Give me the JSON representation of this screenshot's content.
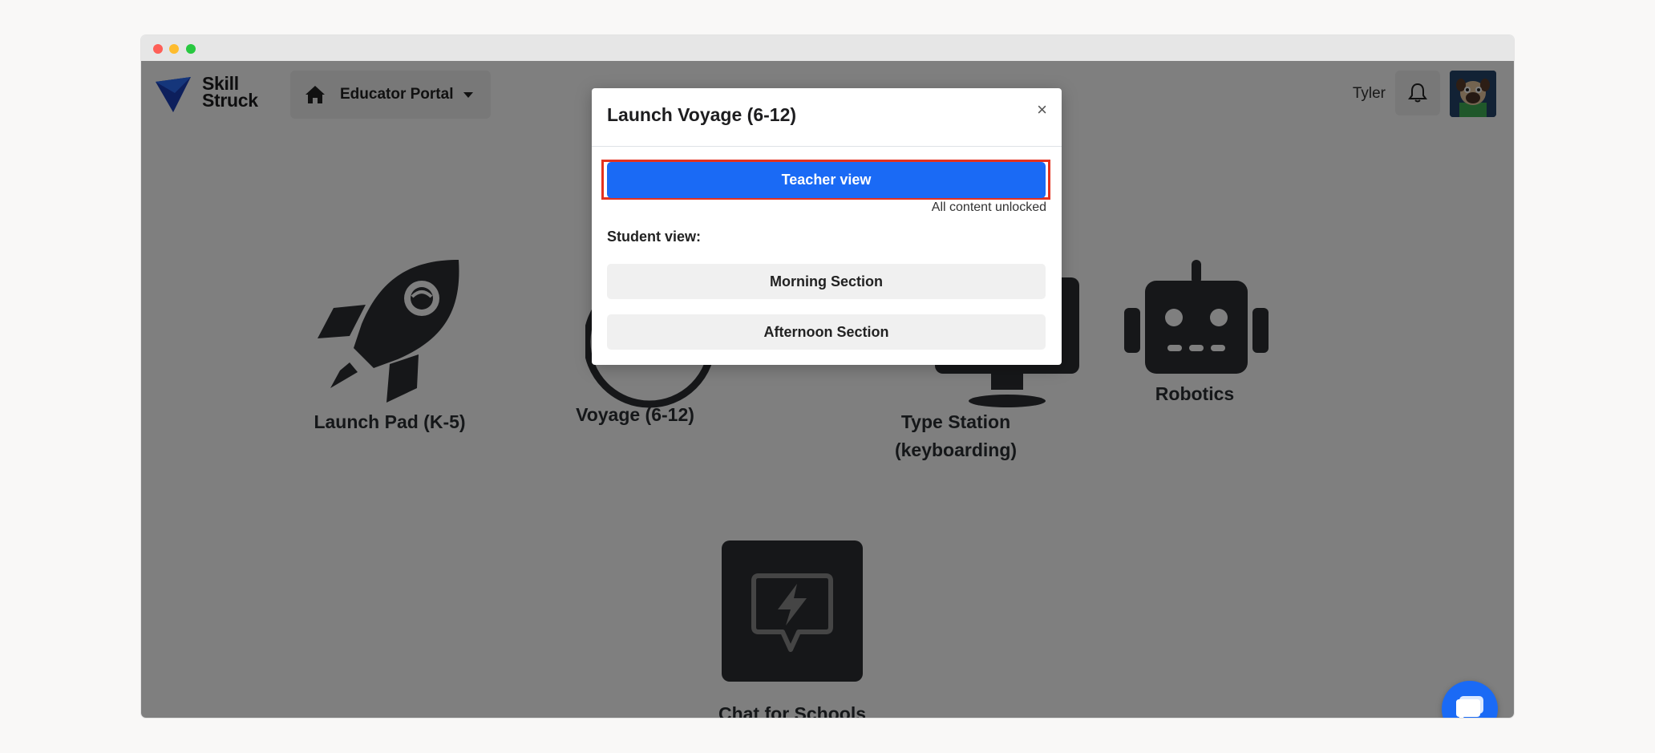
{
  "header": {
    "logo": {
      "line1": "Skill",
      "line2": "Struck"
    },
    "portal_label": "Educator Portal",
    "user_name": "Tyler"
  },
  "products": [
    {
      "label": "Launch Pad (K-5)",
      "icon": "rocket-icon"
    },
    {
      "label": "Voyage (6-12)",
      "icon": "globe-icon"
    },
    {
      "label_line1": "Type Station",
      "label_line2": "(keyboarding)",
      "icon": "keyboard-station-icon"
    },
    {
      "label": "Robotics",
      "icon": "robot-icon"
    },
    {
      "label": "Chat for Schools",
      "icon": "chat-lightning-icon"
    }
  ],
  "modal": {
    "title": "Launch Voyage (6-12)",
    "close": "×",
    "teacher_button": "Teacher view",
    "teacher_note": "All content unlocked",
    "student_label": "Student view:",
    "sections": [
      "Morning Section",
      "Afternoon Section"
    ]
  },
  "colors": {
    "accent": "#1a6af5",
    "highlight": "#e4321f",
    "icon_dark": "#2c2f33"
  }
}
